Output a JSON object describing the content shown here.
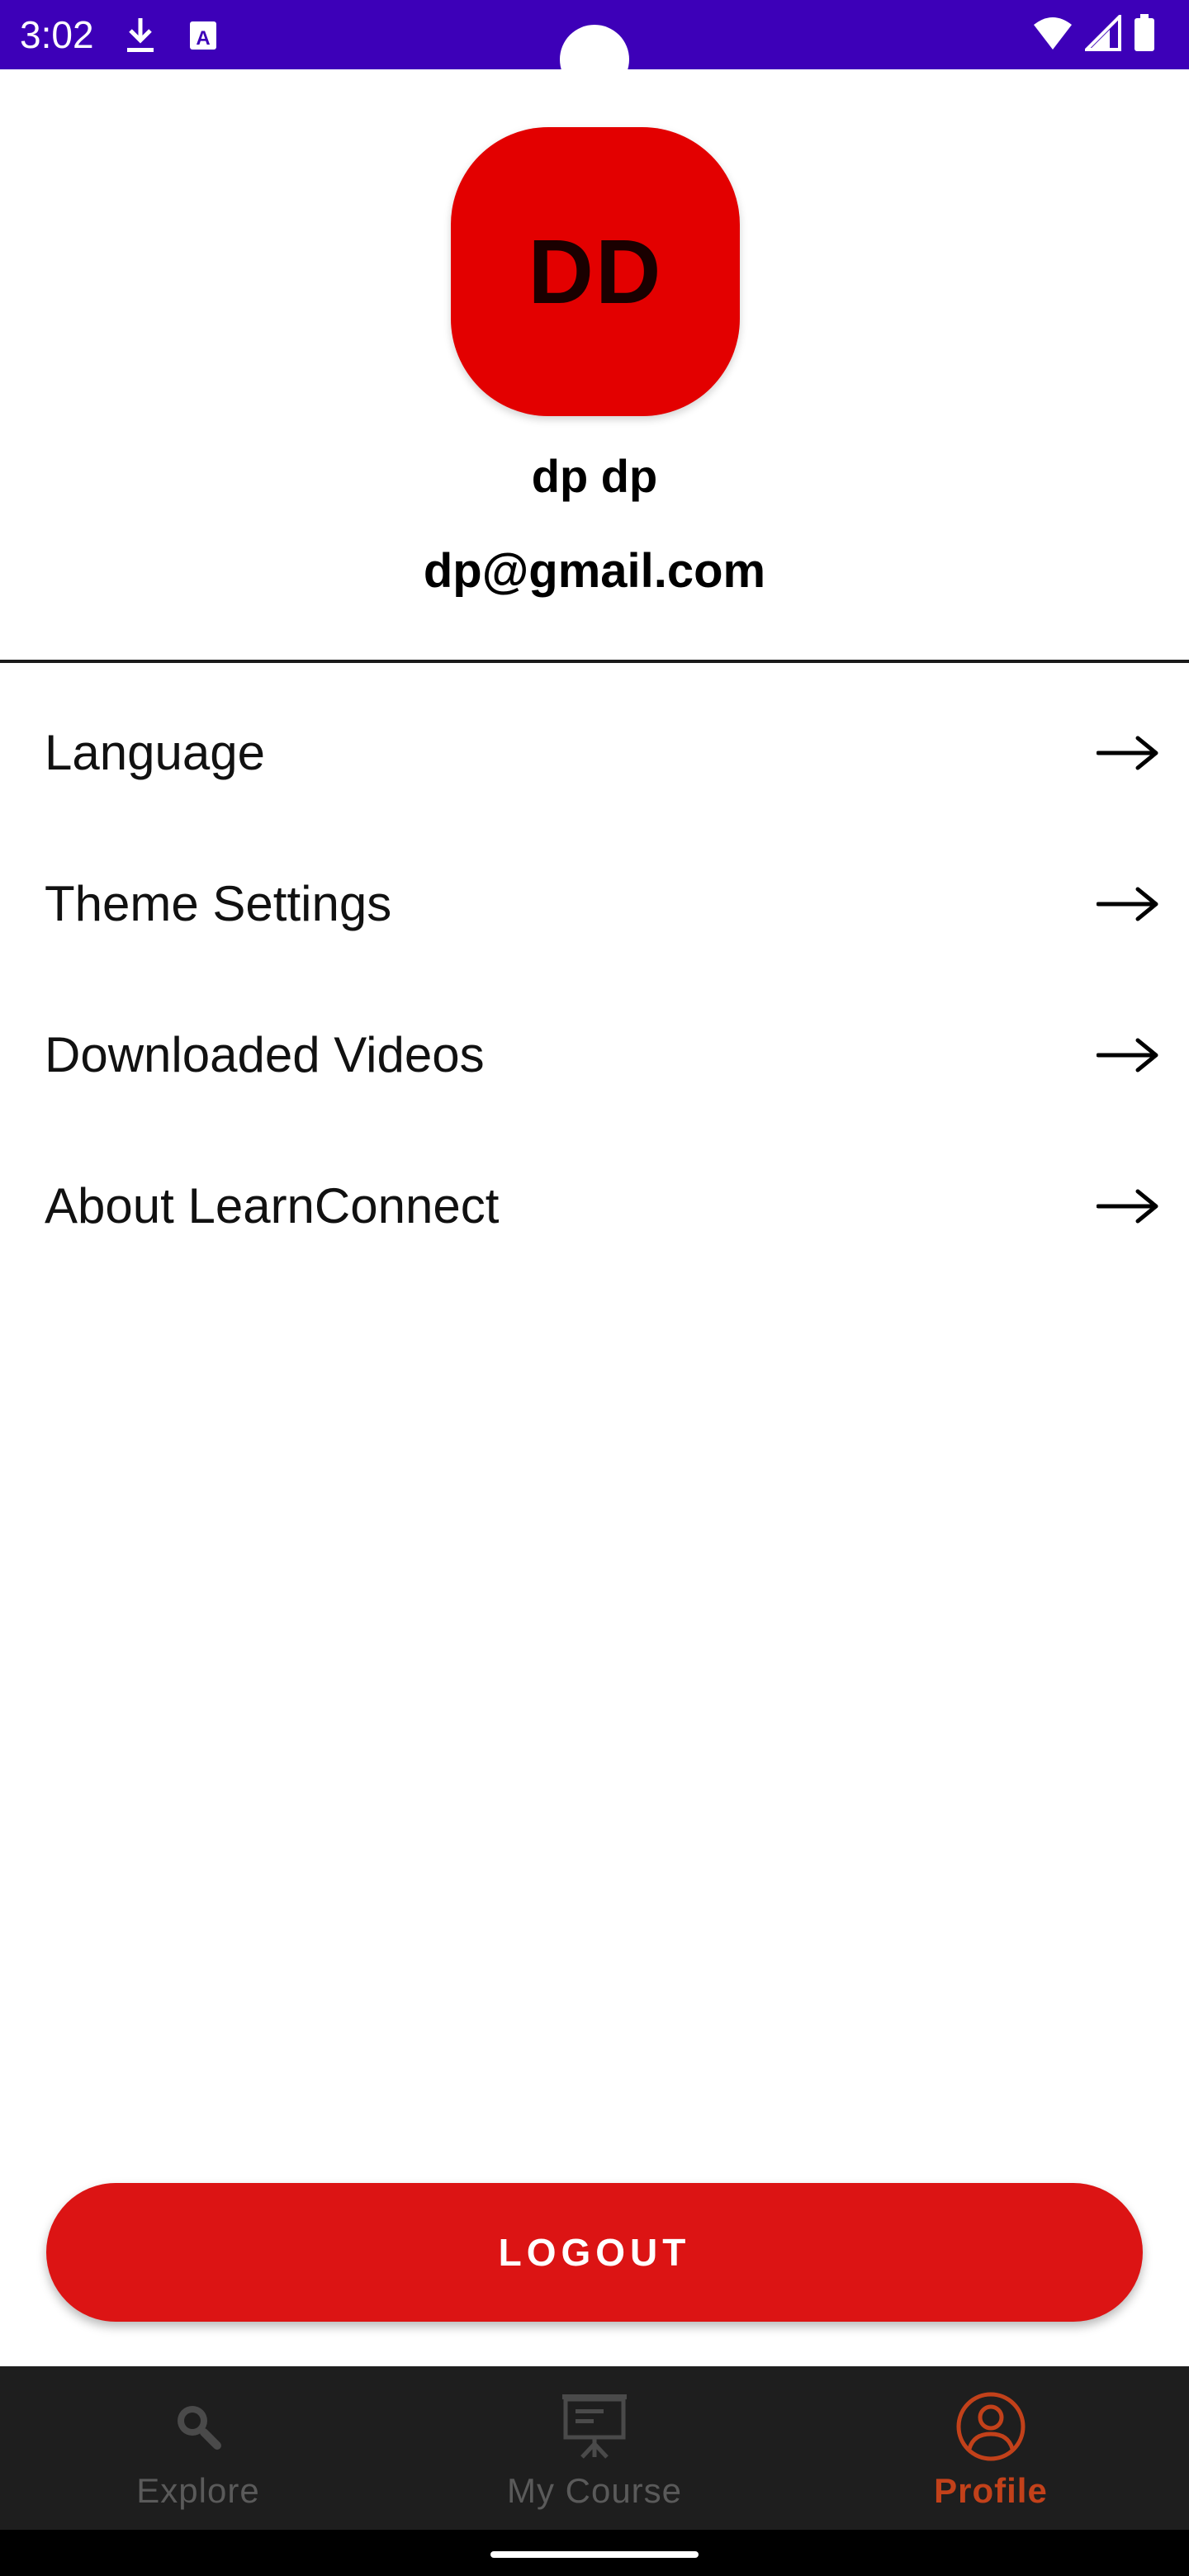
{
  "status_bar": {
    "time": "3:02",
    "background": "#3d00b8",
    "icons": [
      "download-icon",
      "a11y-icon",
      "wifi-icon",
      "cell-signal-icon",
      "battery-icon"
    ]
  },
  "profile": {
    "initials": "DD",
    "name": "dp dp",
    "email": "dp@gmail.com",
    "avatar_color": "#e30000"
  },
  "menu": {
    "items": [
      {
        "label": "Language",
        "icon": "arrow-right-icon"
      },
      {
        "label": "Theme Settings",
        "icon": "arrow-right-icon"
      },
      {
        "label": "Downloaded Videos",
        "icon": "arrow-right-icon"
      },
      {
        "label": "About LearnConnect",
        "icon": "arrow-right-icon"
      }
    ]
  },
  "logout": {
    "label": "LOGOUT",
    "color": "#dc1414"
  },
  "bottom_nav": {
    "items": [
      {
        "label": "Explore",
        "icon": "search-icon",
        "active": false
      },
      {
        "label": "My Course",
        "icon": "presentation-board-icon",
        "active": false
      },
      {
        "label": "Profile",
        "icon": "person-circle-icon",
        "active": true
      }
    ],
    "active_color": "#c2411a",
    "inactive_color": "#5a5a5a"
  }
}
